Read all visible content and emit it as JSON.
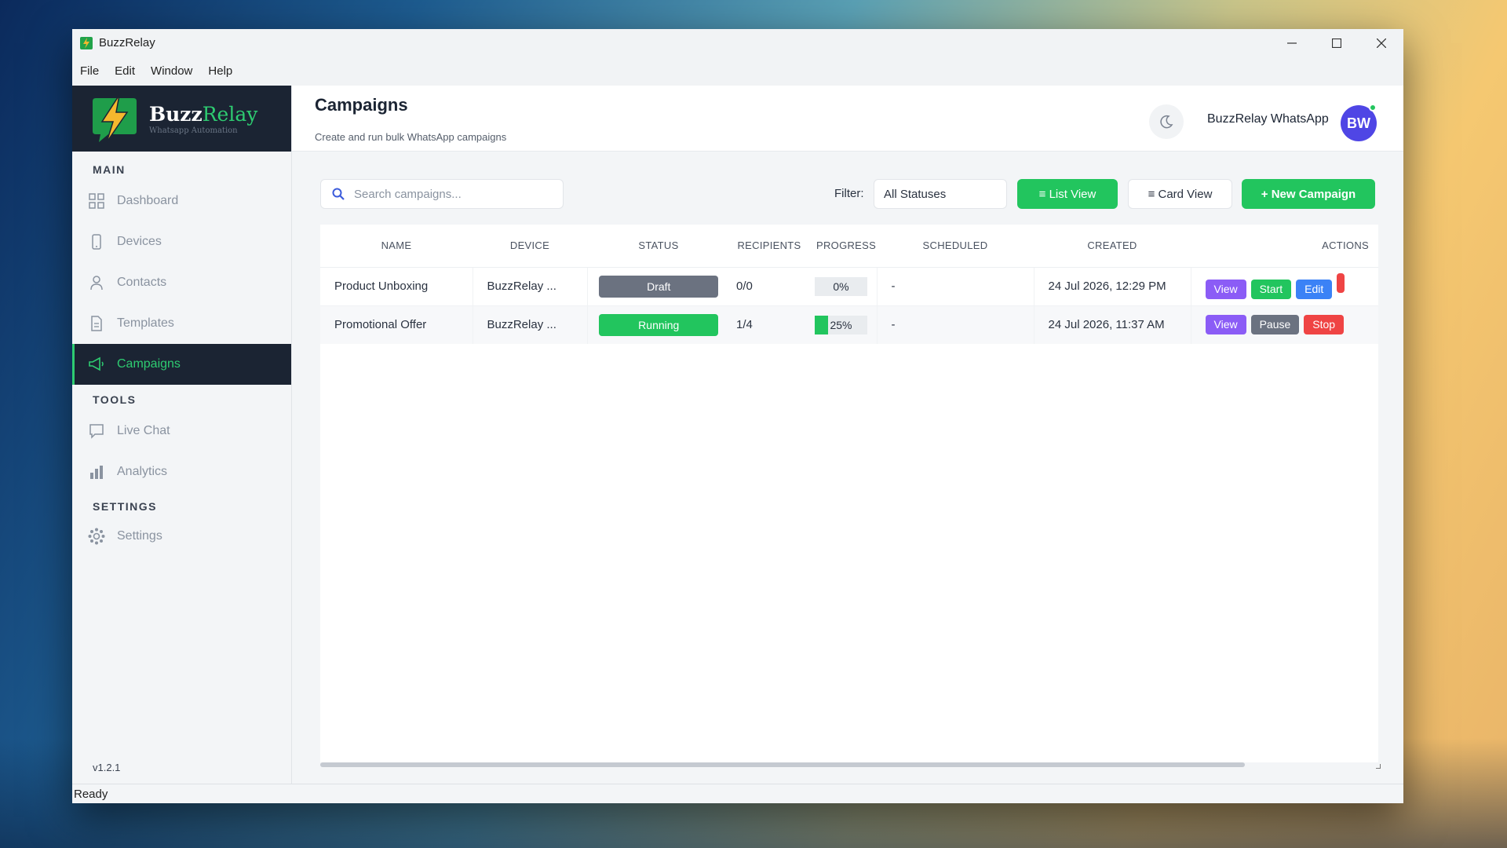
{
  "window": {
    "title": "BuzzRelay"
  },
  "menu": [
    "File",
    "Edit",
    "Window",
    "Help"
  ],
  "brand": {
    "name_a": "Buzz",
    "name_b": "Relay",
    "tagline": "Whatsapp Automation"
  },
  "sidebar": {
    "sections": {
      "main": "MAIN",
      "tools": "TOOLS",
      "settings": "SETTINGS"
    },
    "items": [
      {
        "label": "Dashboard",
        "icon": "dashboard-icon"
      },
      {
        "label": "Devices",
        "icon": "phone-icon"
      },
      {
        "label": "Contacts",
        "icon": "user-icon"
      },
      {
        "label": "Templates",
        "icon": "document-icon"
      },
      {
        "label": "Campaigns",
        "icon": "megaphone-icon",
        "active": true
      },
      {
        "label": "Live Chat",
        "icon": "chat-icon"
      },
      {
        "label": "Analytics",
        "icon": "bar-chart-icon"
      },
      {
        "label": "Settings",
        "icon": "gear-icon"
      }
    ],
    "version": "v1.2.1"
  },
  "header": {
    "title": "Campaigns",
    "subtitle": "Create and run bulk WhatsApp campaigns",
    "user": "BuzzRelay WhatsApp",
    "avatar": "BW"
  },
  "toolbar": {
    "search_placeholder": "Search campaigns...",
    "filter_label": "Filter:",
    "filter_value": "All Statuses",
    "list_view": "≡  List View",
    "card_view": "≡  Card View",
    "new_campaign": "+ New Campaign"
  },
  "table": {
    "headers": [
      "NAME",
      "DEVICE",
      "STATUS",
      "RECIPIENTS",
      "PROGRESS",
      "SCHEDULED",
      "CREATED",
      "ACTIONS"
    ],
    "rows": [
      {
        "name": "Product Unboxing",
        "device": "BuzzRelay ...",
        "status": "Draft",
        "recipients": "0/0",
        "progress": 0,
        "progress_label": "0%",
        "scheduled": "-",
        "created": "24 Jul 2026, 12:29 PM",
        "actions": [
          "View",
          "Start",
          "Edit"
        ]
      },
      {
        "name": "Promotional Offer",
        "device": "BuzzRelay ...",
        "status": "Running",
        "recipients": "1/4",
        "progress": 25,
        "progress_label": "25%",
        "scheduled": "-",
        "created": "24 Jul 2026, 11:37 AM",
        "actions": [
          "View",
          "Pause",
          "Stop"
        ]
      }
    ]
  },
  "colors": {
    "accent_green": "#22c55e",
    "draft_gray": "#6b7280",
    "view_purple": "#8b5cf6",
    "edit_blue": "#3b82f6",
    "stop_red": "#ef4444",
    "sidebar_dark": "#1b2433"
  },
  "statusbar": "Ready"
}
